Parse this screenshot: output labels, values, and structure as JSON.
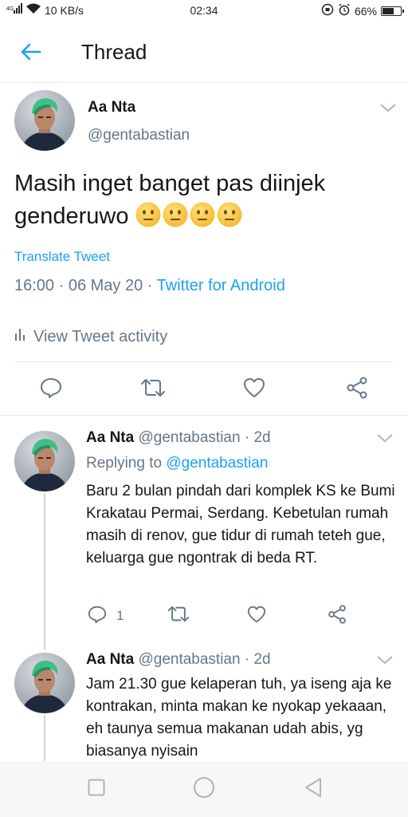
{
  "status_bar": {
    "network_speed": "10 KB/s",
    "time": "02:34",
    "battery": "66%",
    "battery_level": 0.66
  },
  "header": {
    "title": "Thread"
  },
  "main_tweet": {
    "name": "Aa Nta",
    "handle": "@gentabastian",
    "text": "Masih inget banget pas diinjek genderuwo",
    "emoji_count": 4,
    "translate_label": "Translate Tweet",
    "time": "16:00",
    "date": "06 May 20",
    "separator": " · ",
    "source": "Twitter for Android",
    "activity_label": "View Tweet activity"
  },
  "replies": [
    {
      "name": "Aa Nta",
      "handle": "@gentabastian",
      "age": "· 2d",
      "replying_label": "Replying to",
      "replying_handle": "@gentabastian",
      "text": "Baru 2 bulan pindah dari komplek KS ke Bumi Krakatau Permai, Serdang. Kebetulan rumah masih di renov, gue tidur di rumah teteh gue, keluarga gue ngontrak di beda RT.",
      "reply_count": "1"
    },
    {
      "name": "Aa Nta",
      "handle": "@gentabastian",
      "age": "· 2d",
      "text": "Jam 21.30 gue kelaperan tuh, ya iseng aja ke kontrakan, minta makan ke nyokap yekaaan, eh taunya semua makanan udah abis, yg biasanya nyisain"
    }
  ],
  "colors": {
    "accent": "#1da1f2",
    "muted": "#657786",
    "text": "#14171a",
    "divider": "#e6ecf0"
  },
  "icons": [
    "back-arrow-icon",
    "chevron-down-icon",
    "reply-icon",
    "retweet-icon",
    "like-icon",
    "share-icon",
    "bar-chart-icon",
    "nav-square-icon",
    "nav-circle-icon",
    "nav-triangle-icon"
  ]
}
